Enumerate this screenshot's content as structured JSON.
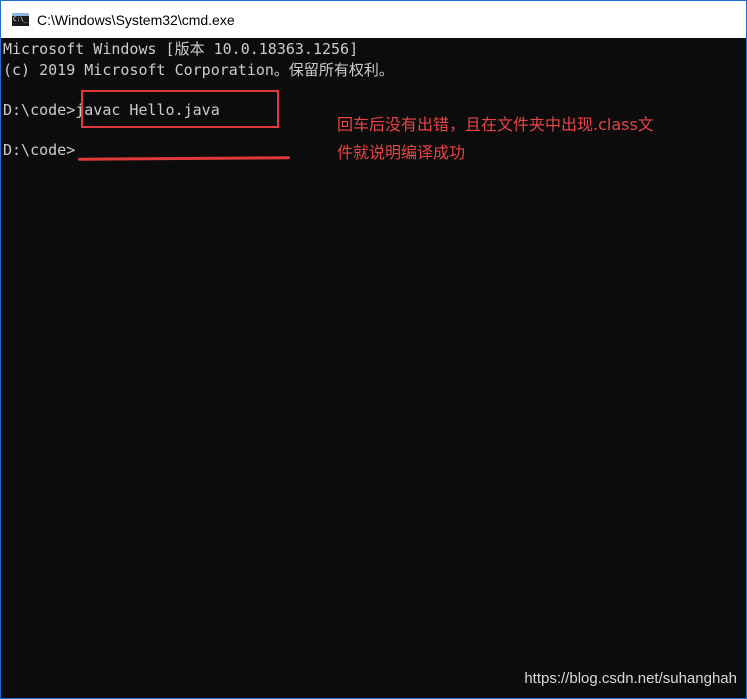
{
  "window": {
    "title": "C:\\Windows\\System32\\cmd.exe",
    "icon": "console-app-icon",
    "accent_color": "#1f6fd1"
  },
  "console": {
    "lines": [
      "Microsoft Windows [版本 10.0.18363.1256]",
      "(c) 2019 Microsoft Corporation。保留所有权利。",
      "",
      "D:\\code>javac Hello.java",
      "",
      "D:\\code>"
    ],
    "text_color": "#cccccc",
    "background_color": "#0c0c0c"
  },
  "annotation": {
    "line1": "回车后没有出错，且在文件夹中出现.class文",
    "line2": "件就说明编译成功",
    "color": "#e84545"
  },
  "watermark": "https://blog.csdn.net/suhanghah"
}
